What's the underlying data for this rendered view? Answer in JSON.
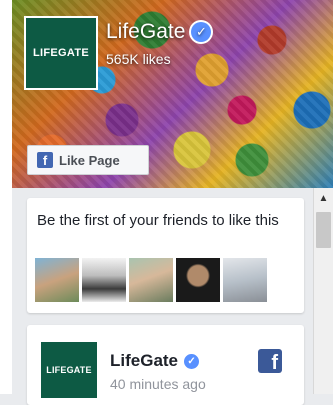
{
  "page": {
    "name": "LifeGate",
    "likes": "565K likes",
    "logo_text": "LIFEGATE",
    "verified_icon": "check-icon"
  },
  "like_button": {
    "label": "Like Page",
    "icon": "facebook-f-icon"
  },
  "friends": {
    "text": "Be the first of your friends to like this",
    "avatars": [
      "friend-avatar-1",
      "friend-avatar-2",
      "friend-avatar-3",
      "friend-avatar-4",
      "friend-avatar-5"
    ]
  },
  "post": {
    "author": "LifeGate",
    "time": "40 minutes ago",
    "logo_text": "LIFEGATE",
    "network_icon": "facebook-logo-icon"
  },
  "colors": {
    "brand_green": "#0d5a44",
    "facebook_blue": "#3b5998",
    "verified_blue": "#5890ff"
  }
}
